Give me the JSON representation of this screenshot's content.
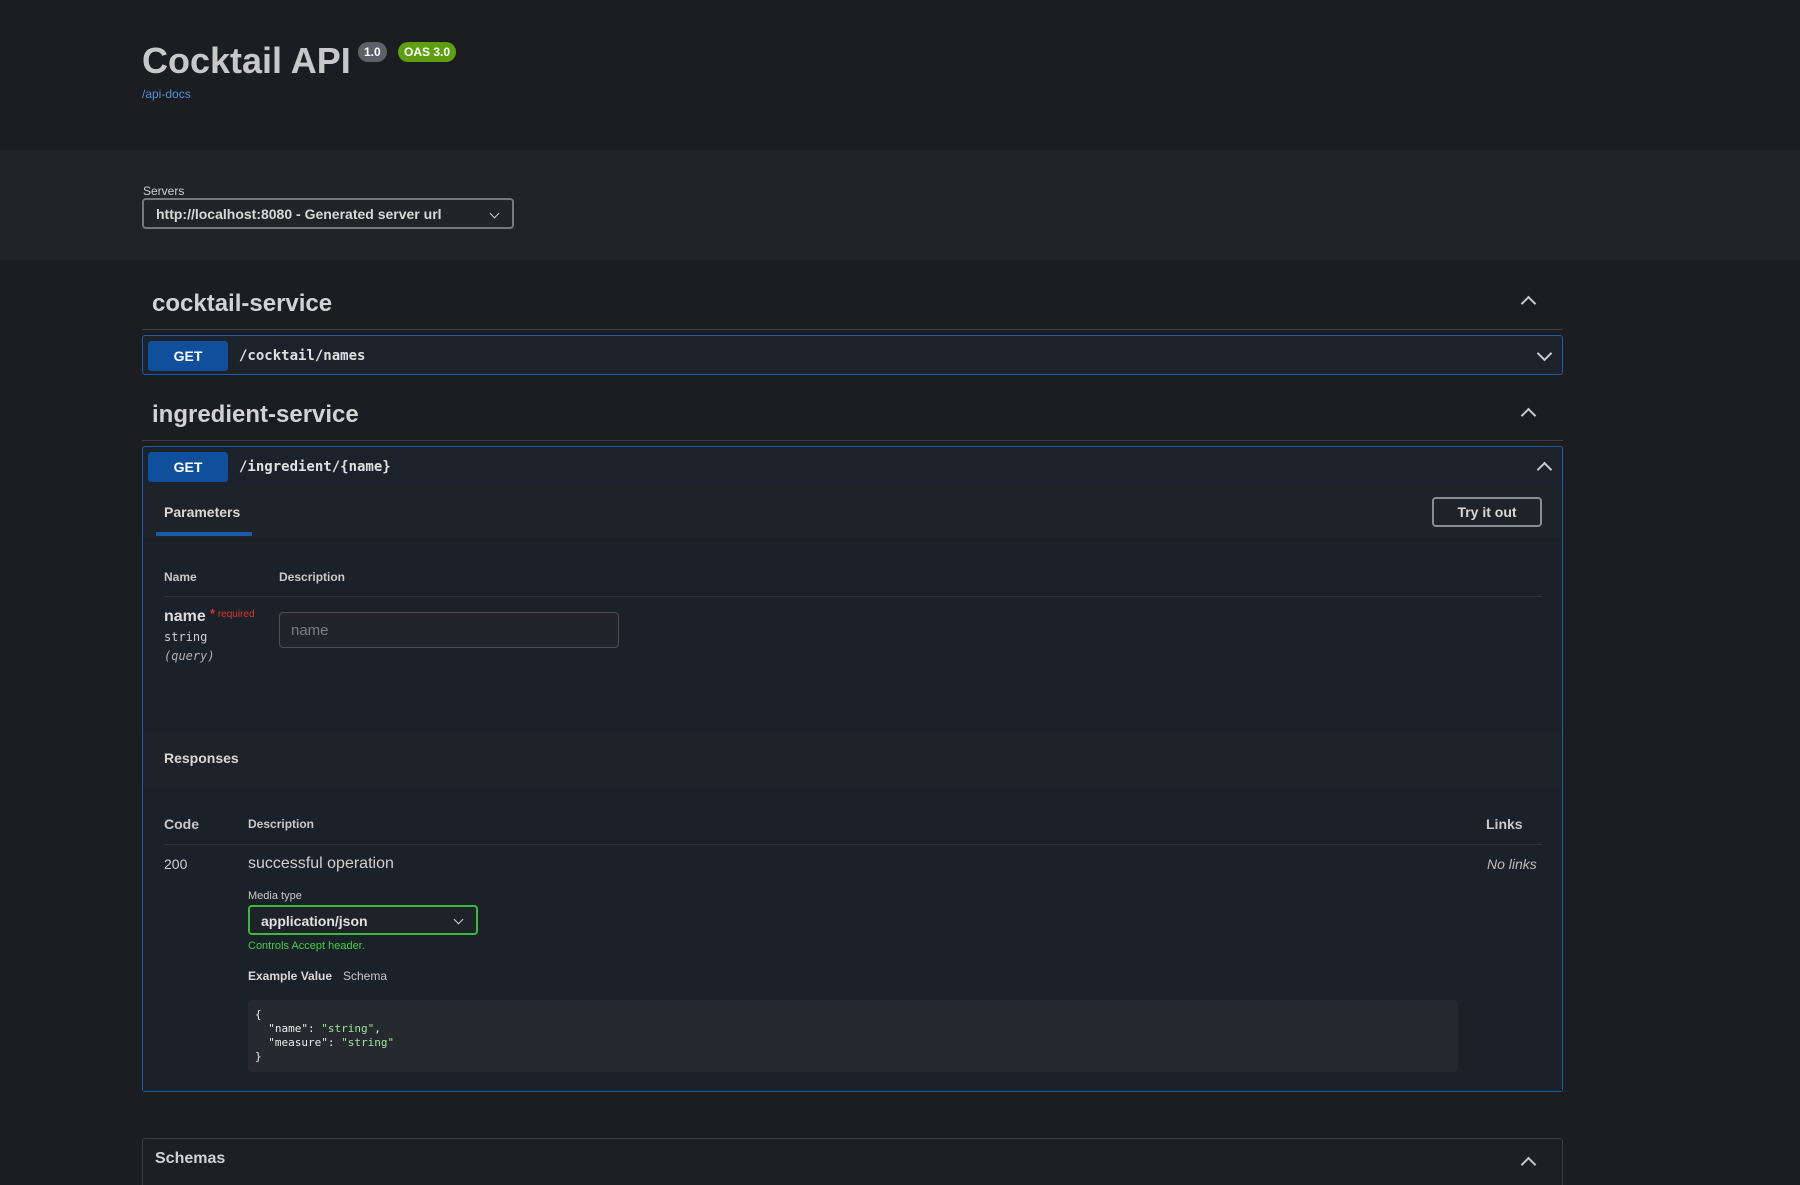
{
  "info": {
    "title": "Cocktail API",
    "version_badge": "1.0",
    "oas_badge": "OAS 3.0",
    "docs_link": "/api-docs"
  },
  "servers": {
    "label": "Servers",
    "selected": "http://localhost:8080 - Generated server url"
  },
  "tags": [
    {
      "name": "cocktail-service",
      "operations": [
        {
          "method": "GET",
          "path": "/cocktail/names",
          "expanded": false
        }
      ]
    },
    {
      "name": "ingredient-service",
      "operations": [
        {
          "method": "GET",
          "path": "/ingredient/{name}",
          "expanded": true
        }
      ]
    }
  ],
  "operation": {
    "parameters_tab": "Parameters",
    "try_it_out": "Try it out",
    "param_headers": {
      "name": "Name",
      "description": "Description"
    },
    "param": {
      "name": "name",
      "required_star": "*",
      "required_label": "required",
      "type": "string",
      "in": "(query)",
      "placeholder": "name"
    },
    "responses_title": "Responses",
    "response_headers": {
      "code": "Code",
      "description": "Description",
      "links": "Links"
    },
    "response": {
      "code": "200",
      "description": "successful operation",
      "links": "No links",
      "media_type_label": "Media type",
      "media_type": "application/json",
      "controls_note": "Controls Accept header.",
      "example_tab": "Example Value",
      "schema_tab": "Schema",
      "example_lines": {
        "open": "{",
        "name_key": "  \"name\": ",
        "name_val": "\"string\"",
        "measure_key": "  \"measure\": ",
        "measure_val": "\"string\"",
        "close": "}"
      }
    }
  },
  "schemas_title": "Schemas",
  "colors": {
    "get_method": "#0f4f9c",
    "opblock_border": "#1f5ca8",
    "oas_badge": "#5e9e13",
    "media_select_border": "#3fb93c",
    "required": "#e0342f"
  }
}
